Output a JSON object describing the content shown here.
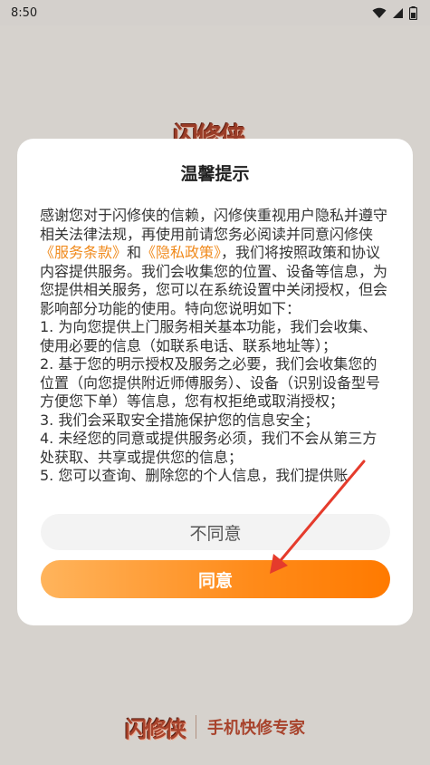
{
  "status_bar": {
    "time": "8:50"
  },
  "background": {
    "logo_text": "闪修侠",
    "footer_logo": "闪修侠",
    "footer_slogan": "手机快修专家"
  },
  "dialog": {
    "title": "温馨提示",
    "body_intro": "感谢您对于闪修侠的信赖，闪修侠重视用户隐私并遵守相关法律法规，再使用前请您务必阅读并同意闪修侠",
    "terms_link": "《服务条款》",
    "and_text": "和",
    "privacy_link": "《隐私政策》",
    "body_after_links": "，我们将按照政策和协议内容提供服务。我们会收集您的位置、设备等信息，为您提供相关服务，您可以在系统设置中关闭授权，但会影响部分功能的使用。特向您说明如下：",
    "items": [
      "1. 为向您提供上门服务相关基本功能，我们会收集、使用必要的信息（如联系电话、联系地址等）；",
      "2. 基于您的明示授权及服务之必要，我们会收集您的位置（向您提供附近师傅服务）、设备（识别设备型号方便您下单）等信息，您有权拒绝或取消授权；",
      "3. 我们会采取安全措施保护您的信息安全；",
      "4. 未经您的同意或提供服务必须，我们不会从第三方处获取、共享或提供您的信息；",
      "5. 您可以查询、删除您的个人信息，我们提供账"
    ],
    "disagree_label": "不同意",
    "agree_label": "同意"
  },
  "colors": {
    "accent": "#ff8b1a",
    "link": "#f08a1c",
    "arrow": "#e53b2c",
    "brand": "#a8432c"
  }
}
